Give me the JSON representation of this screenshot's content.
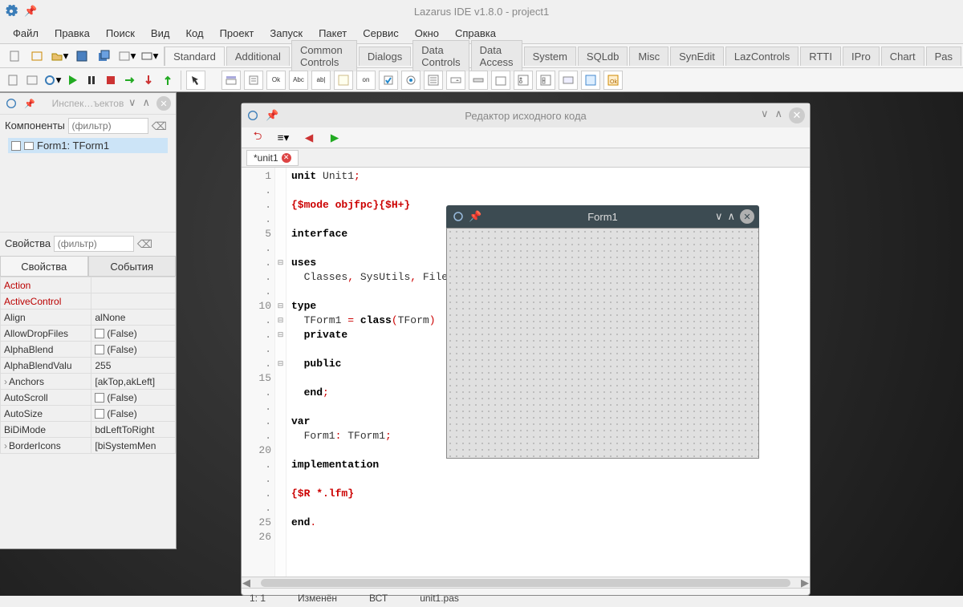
{
  "main": {
    "title": "Lazarus IDE v1.8.0 - project1",
    "menu": [
      "Файл",
      "Правка",
      "Поиск",
      "Вид",
      "Код",
      "Проект",
      "Запуск",
      "Пакет",
      "Сервис",
      "Окно",
      "Справка"
    ],
    "palette_tabs": [
      "Standard",
      "Additional",
      "Common Controls",
      "Dialogs",
      "Data Controls",
      "Data Access",
      "System",
      "SQLdb",
      "Misc",
      "SynEdit",
      "LazControls",
      "RTTI",
      "IPro",
      "Chart",
      "Pas"
    ]
  },
  "inspector": {
    "title": "Инспек…ъектов",
    "components_label": "Компоненты",
    "properties_label": "Свойства",
    "filter_placeholder": "(фильтр)",
    "tree_item": "Form1: TForm1",
    "tabs": [
      "Свойства",
      "События"
    ],
    "props": [
      {
        "name": "Action",
        "value": "",
        "red": true
      },
      {
        "name": "ActiveControl",
        "value": "",
        "red": true
      },
      {
        "name": "Align",
        "value": "alNone"
      },
      {
        "name": "AllowDropFiles",
        "value": "(False)",
        "checkbox": true
      },
      {
        "name": "AlphaBlend",
        "value": "(False)",
        "checkbox": true
      },
      {
        "name": "AlphaBlendValu",
        "value": "255"
      },
      {
        "name": "Anchors",
        "value": "[akTop,akLeft]",
        "expand": true
      },
      {
        "name": "AutoScroll",
        "value": "(False)",
        "checkbox": true
      },
      {
        "name": "AutoSize",
        "value": "(False)",
        "checkbox": true
      },
      {
        "name": "BiDiMode",
        "value": "bdLeftToRight"
      },
      {
        "name": "BorderIcons",
        "value": "[biSystemMen",
        "expand": true
      }
    ]
  },
  "editor": {
    "title": "Редактор исходного кода",
    "file_tab": "*unit1",
    "status": {
      "pos": "1: 1",
      "state": "Изменён",
      "mode": "ВСТ",
      "file": "unit1.pas"
    },
    "gutter": [
      "1",
      ".",
      ".",
      ".",
      "5",
      ".",
      ".",
      ".",
      ".",
      "10",
      ".",
      ".",
      ".",
      ".",
      "15",
      ".",
      ".",
      ".",
      ".",
      "20",
      ".",
      ".",
      ".",
      ".",
      "25",
      "26"
    ]
  },
  "form": {
    "title": "Form1"
  }
}
